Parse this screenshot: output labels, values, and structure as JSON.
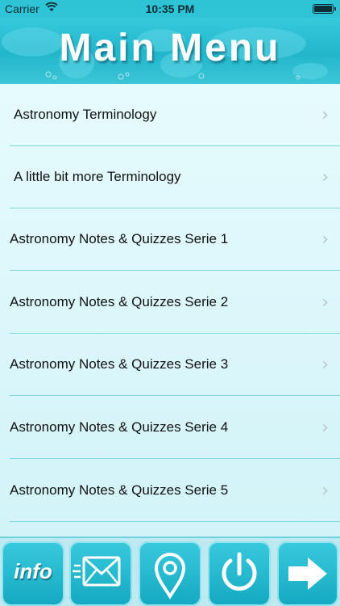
{
  "status": {
    "carrier": "Carrier",
    "time": "10:35 PM"
  },
  "header": {
    "title": "Main Menu"
  },
  "menu": {
    "items": [
      {
        "label": "Astronomy Terminology"
      },
      {
        "label": "A little bit more Terminology"
      },
      {
        "label": "Astronomy Notes & Quizzes Serie 1"
      },
      {
        "label": "Astronomy Notes & Quizzes Serie 2"
      },
      {
        "label": "Astronomy Notes & Quizzes Serie 3"
      },
      {
        "label": "Astronomy Notes & Quizzes Serie 4"
      },
      {
        "label": "Astronomy Notes & Quizzes Serie 5"
      }
    ],
    "chevron": "›"
  },
  "toolbar": {
    "info_label": "info",
    "buttons": [
      {
        "icon": "info-icon"
      },
      {
        "icon": "mail-icon"
      },
      {
        "icon": "location-pin-icon"
      },
      {
        "icon": "power-icon"
      },
      {
        "icon": "arrow-right-icon"
      }
    ]
  },
  "colors": {
    "accent": "#22b6cb",
    "list_background": "#e6fbfd",
    "separator": "#7ed9e5"
  }
}
